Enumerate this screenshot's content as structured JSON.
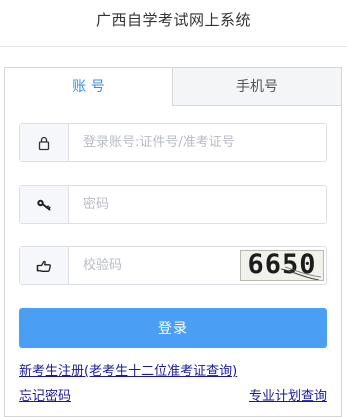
{
  "header": {
    "title": "广西自学考试网上系统"
  },
  "tabs": [
    {
      "label": "账 号",
      "active": true
    },
    {
      "label": "手机号",
      "active": false
    }
  ],
  "form": {
    "account_placeholder": "登录账号:证件号/准考证号",
    "password_placeholder": "密码",
    "captcha_placeholder": "校验码",
    "captcha_text": "6650",
    "login_label": "登录"
  },
  "links": {
    "register": "新考生注册(老考生十二位准考证查询)",
    "forgot_password": "忘记密码",
    "plan_query": "专业计划查询"
  },
  "colors": {
    "accent": "#3a8ee6",
    "button": "#4a9ff5",
    "link": "#1a1a9c"
  },
  "icons": [
    "lock-icon",
    "key-icon",
    "hand-pointer-icon"
  ]
}
